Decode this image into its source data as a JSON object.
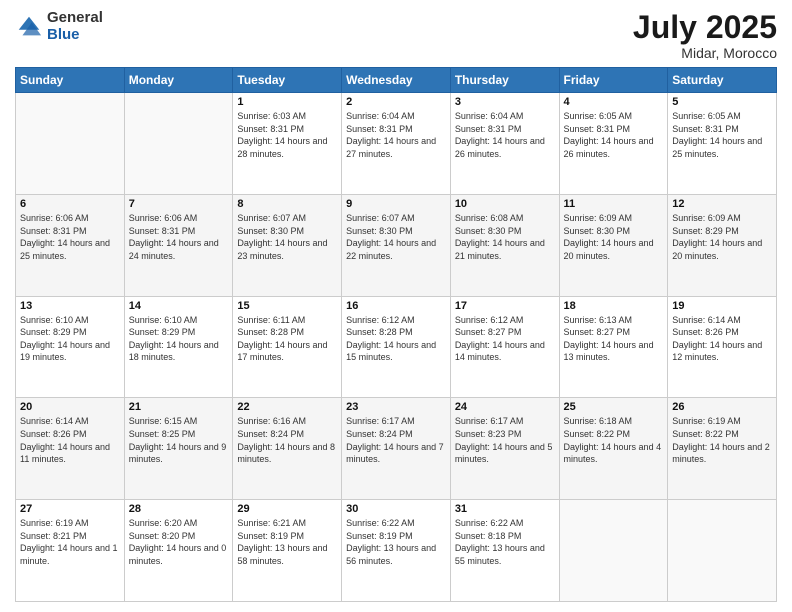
{
  "logo": {
    "general": "General",
    "blue": "Blue"
  },
  "header": {
    "month": "July 2025",
    "location": "Midar, Morocco"
  },
  "weekdays": [
    "Sunday",
    "Monday",
    "Tuesday",
    "Wednesday",
    "Thursday",
    "Friday",
    "Saturday"
  ],
  "weeks": [
    [
      {
        "day": "",
        "sunrise": "",
        "sunset": "",
        "daylight": ""
      },
      {
        "day": "",
        "sunrise": "",
        "sunset": "",
        "daylight": ""
      },
      {
        "day": "1",
        "sunrise": "Sunrise: 6:03 AM",
        "sunset": "Sunset: 8:31 PM",
        "daylight": "Daylight: 14 hours and 28 minutes."
      },
      {
        "day": "2",
        "sunrise": "Sunrise: 6:04 AM",
        "sunset": "Sunset: 8:31 PM",
        "daylight": "Daylight: 14 hours and 27 minutes."
      },
      {
        "day": "3",
        "sunrise": "Sunrise: 6:04 AM",
        "sunset": "Sunset: 8:31 PM",
        "daylight": "Daylight: 14 hours and 26 minutes."
      },
      {
        "day": "4",
        "sunrise": "Sunrise: 6:05 AM",
        "sunset": "Sunset: 8:31 PM",
        "daylight": "Daylight: 14 hours and 26 minutes."
      },
      {
        "day": "5",
        "sunrise": "Sunrise: 6:05 AM",
        "sunset": "Sunset: 8:31 PM",
        "daylight": "Daylight: 14 hours and 25 minutes."
      }
    ],
    [
      {
        "day": "6",
        "sunrise": "Sunrise: 6:06 AM",
        "sunset": "Sunset: 8:31 PM",
        "daylight": "Daylight: 14 hours and 25 minutes."
      },
      {
        "day": "7",
        "sunrise": "Sunrise: 6:06 AM",
        "sunset": "Sunset: 8:31 PM",
        "daylight": "Daylight: 14 hours and 24 minutes."
      },
      {
        "day": "8",
        "sunrise": "Sunrise: 6:07 AM",
        "sunset": "Sunset: 8:30 PM",
        "daylight": "Daylight: 14 hours and 23 minutes."
      },
      {
        "day": "9",
        "sunrise": "Sunrise: 6:07 AM",
        "sunset": "Sunset: 8:30 PM",
        "daylight": "Daylight: 14 hours and 22 minutes."
      },
      {
        "day": "10",
        "sunrise": "Sunrise: 6:08 AM",
        "sunset": "Sunset: 8:30 PM",
        "daylight": "Daylight: 14 hours and 21 minutes."
      },
      {
        "day": "11",
        "sunrise": "Sunrise: 6:09 AM",
        "sunset": "Sunset: 8:30 PM",
        "daylight": "Daylight: 14 hours and 20 minutes."
      },
      {
        "day": "12",
        "sunrise": "Sunrise: 6:09 AM",
        "sunset": "Sunset: 8:29 PM",
        "daylight": "Daylight: 14 hours and 20 minutes."
      }
    ],
    [
      {
        "day": "13",
        "sunrise": "Sunrise: 6:10 AM",
        "sunset": "Sunset: 8:29 PM",
        "daylight": "Daylight: 14 hours and 19 minutes."
      },
      {
        "day": "14",
        "sunrise": "Sunrise: 6:10 AM",
        "sunset": "Sunset: 8:29 PM",
        "daylight": "Daylight: 14 hours and 18 minutes."
      },
      {
        "day": "15",
        "sunrise": "Sunrise: 6:11 AM",
        "sunset": "Sunset: 8:28 PM",
        "daylight": "Daylight: 14 hours and 17 minutes."
      },
      {
        "day": "16",
        "sunrise": "Sunrise: 6:12 AM",
        "sunset": "Sunset: 8:28 PM",
        "daylight": "Daylight: 14 hours and 15 minutes."
      },
      {
        "day": "17",
        "sunrise": "Sunrise: 6:12 AM",
        "sunset": "Sunset: 8:27 PM",
        "daylight": "Daylight: 14 hours and 14 minutes."
      },
      {
        "day": "18",
        "sunrise": "Sunrise: 6:13 AM",
        "sunset": "Sunset: 8:27 PM",
        "daylight": "Daylight: 14 hours and 13 minutes."
      },
      {
        "day": "19",
        "sunrise": "Sunrise: 6:14 AM",
        "sunset": "Sunset: 8:26 PM",
        "daylight": "Daylight: 14 hours and 12 minutes."
      }
    ],
    [
      {
        "day": "20",
        "sunrise": "Sunrise: 6:14 AM",
        "sunset": "Sunset: 8:26 PM",
        "daylight": "Daylight: 14 hours and 11 minutes."
      },
      {
        "day": "21",
        "sunrise": "Sunrise: 6:15 AM",
        "sunset": "Sunset: 8:25 PM",
        "daylight": "Daylight: 14 hours and 9 minutes."
      },
      {
        "day": "22",
        "sunrise": "Sunrise: 6:16 AM",
        "sunset": "Sunset: 8:24 PM",
        "daylight": "Daylight: 14 hours and 8 minutes."
      },
      {
        "day": "23",
        "sunrise": "Sunrise: 6:17 AM",
        "sunset": "Sunset: 8:24 PM",
        "daylight": "Daylight: 14 hours and 7 minutes."
      },
      {
        "day": "24",
        "sunrise": "Sunrise: 6:17 AM",
        "sunset": "Sunset: 8:23 PM",
        "daylight": "Daylight: 14 hours and 5 minutes."
      },
      {
        "day": "25",
        "sunrise": "Sunrise: 6:18 AM",
        "sunset": "Sunset: 8:22 PM",
        "daylight": "Daylight: 14 hours and 4 minutes."
      },
      {
        "day": "26",
        "sunrise": "Sunrise: 6:19 AM",
        "sunset": "Sunset: 8:22 PM",
        "daylight": "Daylight: 14 hours and 2 minutes."
      }
    ],
    [
      {
        "day": "27",
        "sunrise": "Sunrise: 6:19 AM",
        "sunset": "Sunset: 8:21 PM",
        "daylight": "Daylight: 14 hours and 1 minute."
      },
      {
        "day": "28",
        "sunrise": "Sunrise: 6:20 AM",
        "sunset": "Sunset: 8:20 PM",
        "daylight": "Daylight: 14 hours and 0 minutes."
      },
      {
        "day": "29",
        "sunrise": "Sunrise: 6:21 AM",
        "sunset": "Sunset: 8:19 PM",
        "daylight": "Daylight: 13 hours and 58 minutes."
      },
      {
        "day": "30",
        "sunrise": "Sunrise: 6:22 AM",
        "sunset": "Sunset: 8:19 PM",
        "daylight": "Daylight: 13 hours and 56 minutes."
      },
      {
        "day": "31",
        "sunrise": "Sunrise: 6:22 AM",
        "sunset": "Sunset: 8:18 PM",
        "daylight": "Daylight: 13 hours and 55 minutes."
      },
      {
        "day": "",
        "sunrise": "",
        "sunset": "",
        "daylight": ""
      },
      {
        "day": "",
        "sunrise": "",
        "sunset": "",
        "daylight": ""
      }
    ]
  ]
}
